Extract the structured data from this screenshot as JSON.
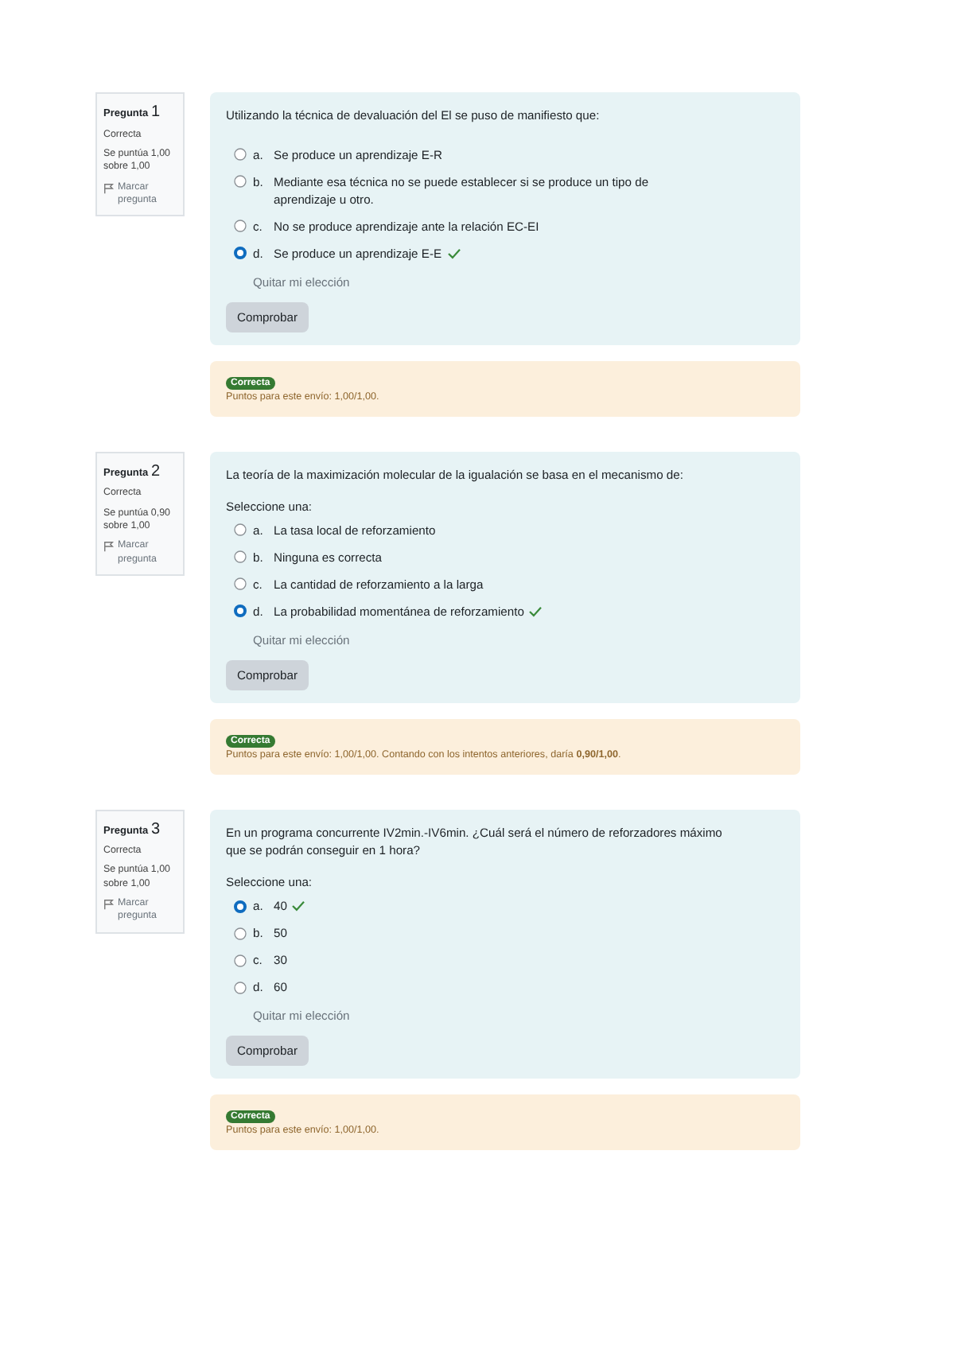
{
  "questions": [
    {
      "label": "Pregunta",
      "number": "1",
      "status": "Correcta",
      "score": "Se puntúa 1,00 sobre 1,00",
      "flag": "Marcar pregunta",
      "text": "Utilizando la técnica de devaluación del El se puso de manifiesto que:",
      "options": [
        {
          "letter": "a.",
          "text": "Se produce un aprendizaje E-R",
          "selected": false,
          "correct": false
        },
        {
          "letter": "b.",
          "text": "Mediante esa técnica no se puede establecer si se produce un tipo de aprendizaje u otro.",
          "selected": false,
          "correct": false
        },
        {
          "letter": "c.",
          "text": "No se produce aprendizaje ante la relación EC-EI",
          "selected": false,
          "correct": false
        },
        {
          "letter": "d.",
          "text": "Se produce un aprendizaje E-E",
          "selected": true,
          "correct": true
        }
      ],
      "clear": "Quitar mi elección",
      "button": "Comprobar",
      "badge": "Correcta",
      "feedback": "Puntos para este envío: 1,00/1,00."
    },
    {
      "label": "Pregunta",
      "number": "2",
      "status": "Correcta",
      "score": "Se puntúa 0,90 sobre 1,00",
      "flag": "Marcar pregunta",
      "text": "La teoría de la maximización molecular de la igualación se basa en el mecanismo de:",
      "prompt": "Seleccione una:",
      "options": [
        {
          "letter": "a.",
          "text": "La tasa local de reforzamiento",
          "selected": false,
          "correct": false
        },
        {
          "letter": "b.",
          "text": "Ninguna es correcta",
          "selected": false,
          "correct": false
        },
        {
          "letter": "c.",
          "text": "La cantidad de reforzamiento a la larga",
          "selected": false,
          "correct": false
        },
        {
          "letter": "d.",
          "text": "La probabilidad momentánea de reforzamiento",
          "selected": true,
          "correct": true
        }
      ],
      "clear": "Quitar mi elección",
      "button": "Comprobar",
      "badge": "Correcta",
      "feedback": "Puntos para este envío: 1,00/1,00. Contando con los intentos anteriores, daría **0,90/1,00**."
    },
    {
      "label": "Pregunta",
      "number": "3",
      "status": "Correcta",
      "score": "Se puntúa 1,00 sobre 1,00",
      "flag": "Marcar pregunta",
      "text": "En un programa concurrente IV2min.-IV6min. ¿Cuál será el número de reforzadores máximo que se podrán conseguir en 1 hora?",
      "prompt": "Seleccione una:",
      "options": [
        {
          "letter": "a.",
          "text": "40",
          "selected": true,
          "correct": true
        },
        {
          "letter": "b.",
          "text": "50",
          "selected": false,
          "correct": false
        },
        {
          "letter": "c.",
          "text": "30",
          "selected": false,
          "correct": false
        },
        {
          "letter": "d.",
          "text": "60",
          "selected": false,
          "correct": false
        }
      ],
      "clear": "Quitar mi elección",
      "button": "Comprobar",
      "badge": "Correcta",
      "feedback": "Puntos para este envío: 1,00/1,00."
    }
  ]
}
